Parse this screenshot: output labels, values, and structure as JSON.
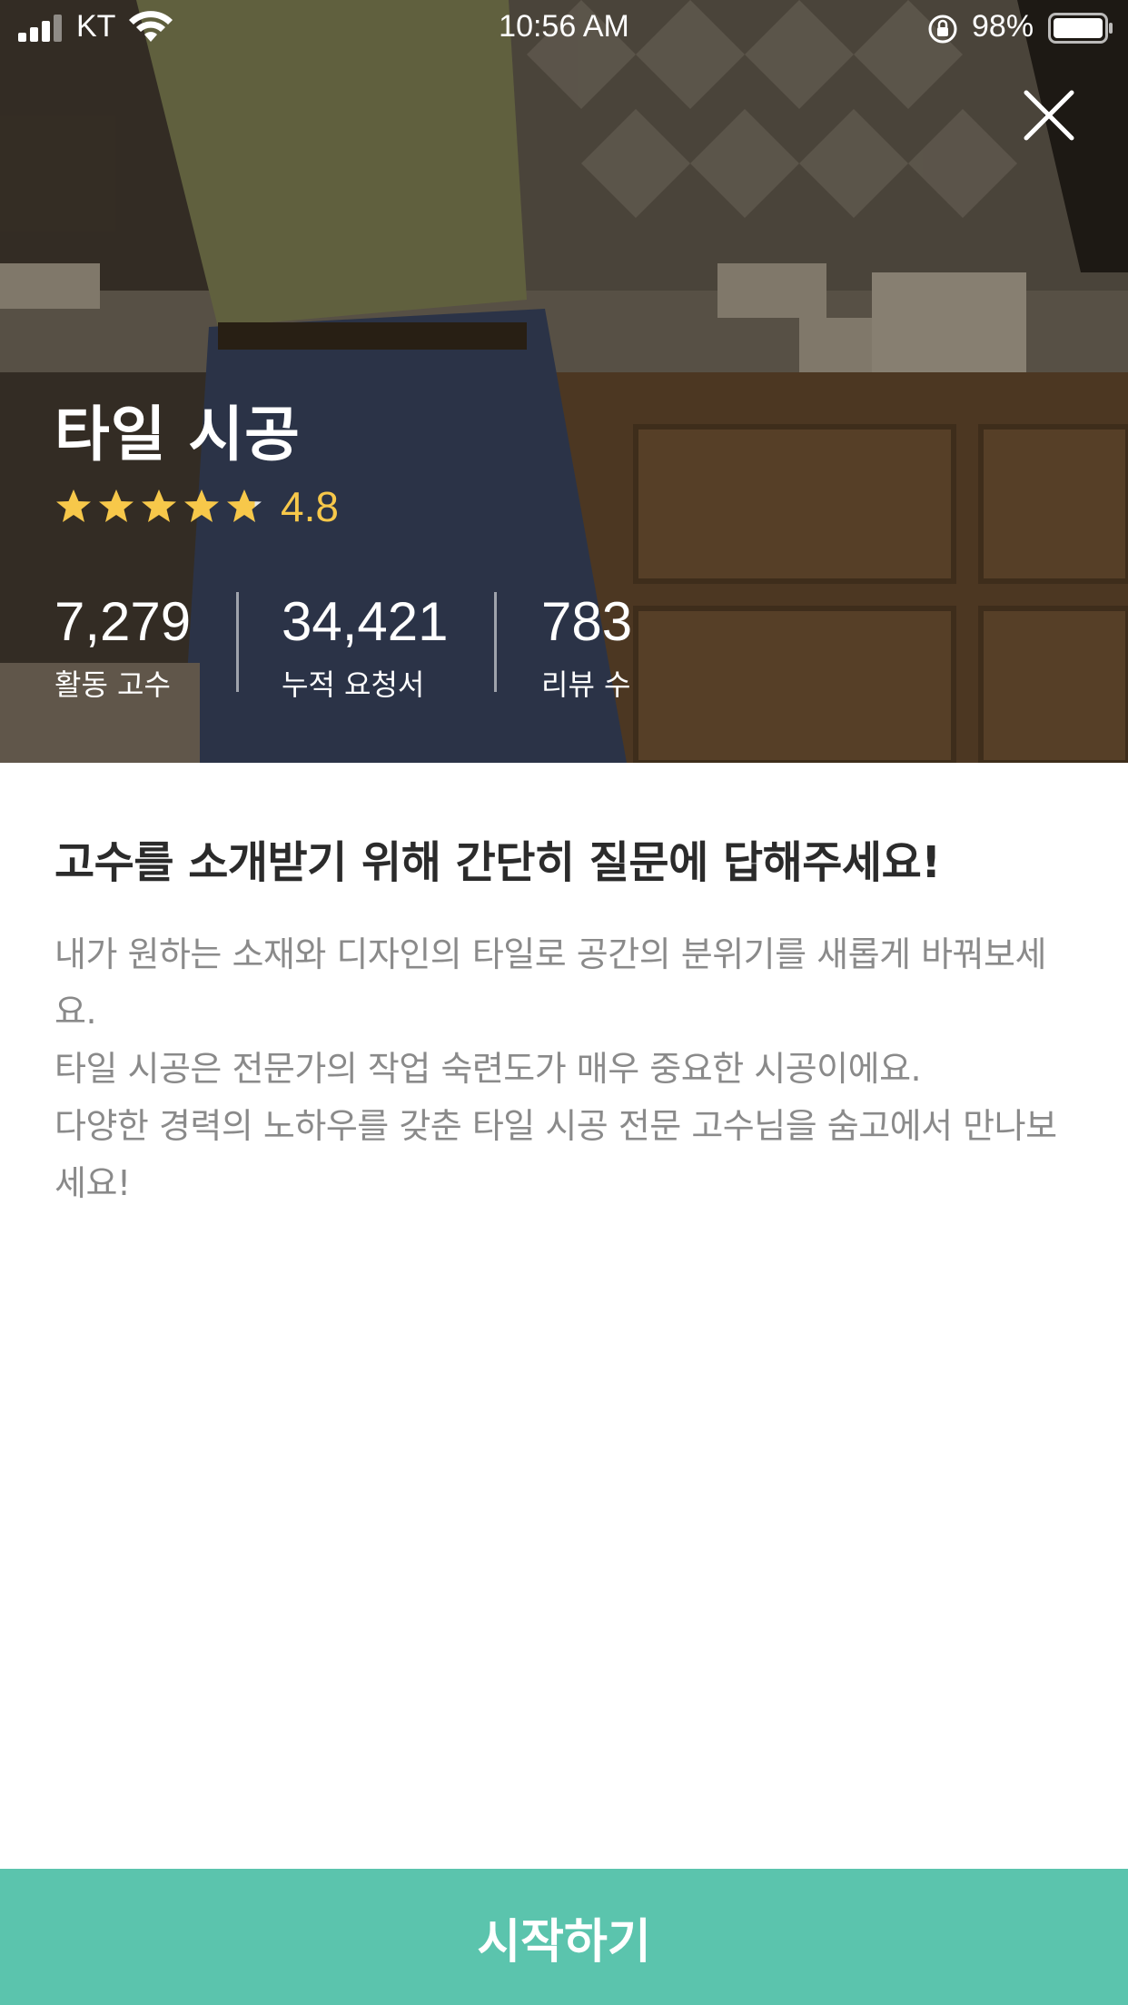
{
  "status_bar": {
    "carrier": "KT",
    "time": "10:56 AM",
    "battery_percent": "98%"
  },
  "hero": {
    "title": "타일 시공",
    "rating": {
      "value_text": "4.8",
      "value": 4.8,
      "max": 5,
      "star_color": "#f7c84a"
    },
    "stats": [
      {
        "value": "7,279",
        "label": "활동 고수"
      },
      {
        "value": "34,421",
        "label": "누적 요청서"
      },
      {
        "value": "783",
        "label": "리뷰 수"
      }
    ]
  },
  "content": {
    "headline": "고수를 소개받기 위해 간단히 질문에 답해주세요!",
    "paragraphs": [
      "내가 원하는 소재와 디자인의 타일로 공간의 분위기를 새롭게 바꿔보세요.",
      "타일 시공은 전문가의 작업 숙련도가 매우 중요한 시공이에요.",
      "다양한 경력의 노하우를 갖춘 타일 시공 전문 고수님을 숨고에서 만나보세요!"
    ]
  },
  "cta": {
    "label": "시작하기",
    "color": "#5bc4ad"
  },
  "icons": {
    "close": "close-icon",
    "star": "star-icon",
    "signal": "cellular-signal-icon",
    "wifi": "wifi-icon",
    "orientation_lock": "orientation-lock-icon",
    "battery": "battery-icon"
  }
}
